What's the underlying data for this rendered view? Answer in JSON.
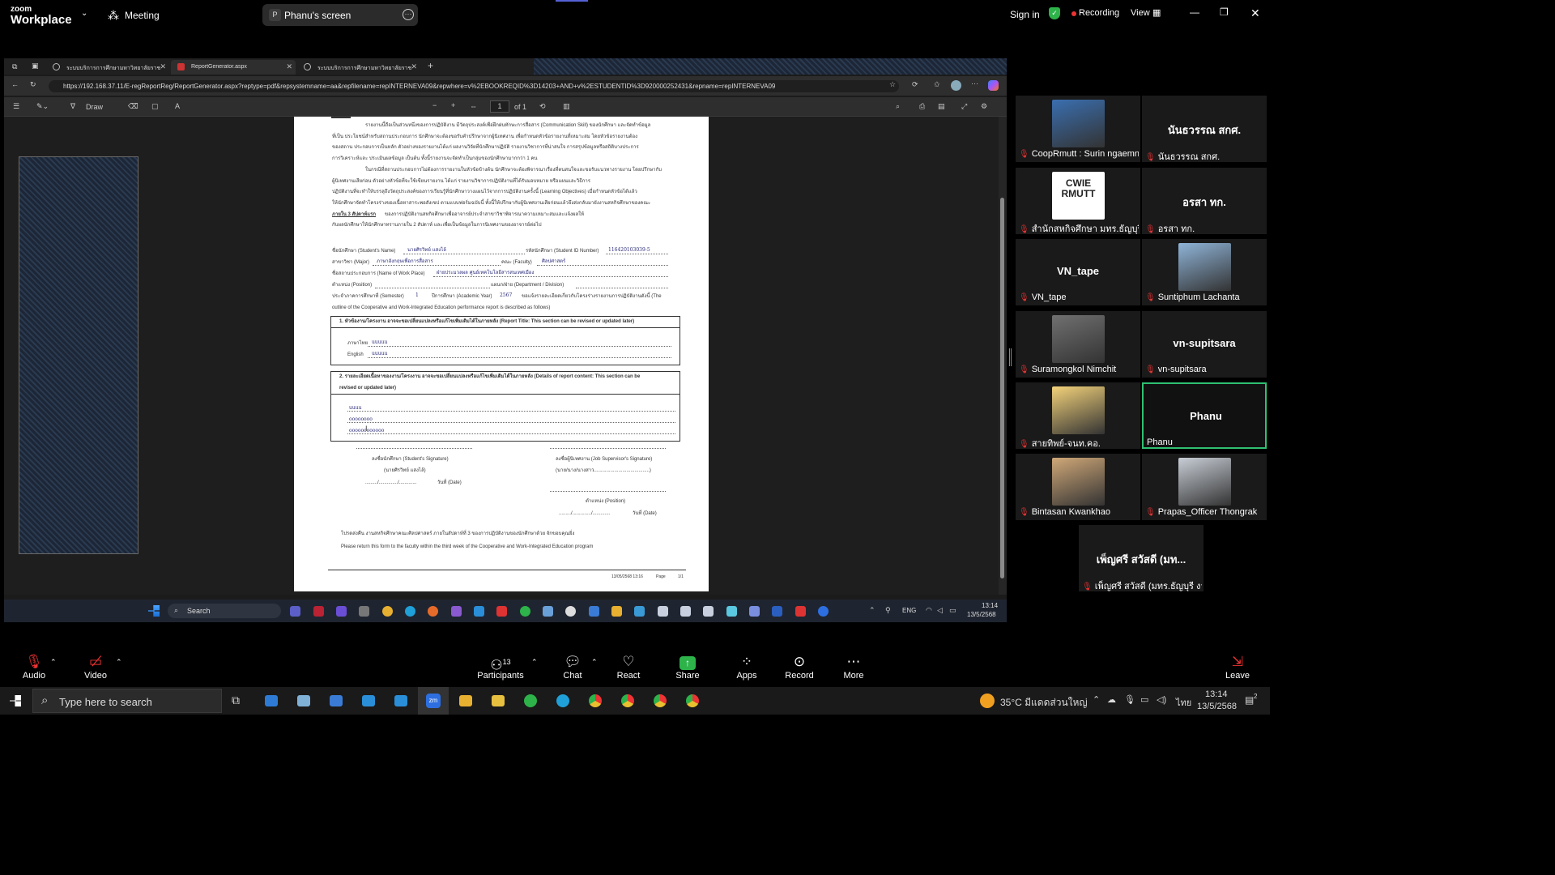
{
  "zoom_top": {
    "logo_small": "zoom",
    "logo_big": "Workplace",
    "meeting_label": "Meeting",
    "share_chip": "P",
    "share_label": "Phanu's screen",
    "sign_in": "Sign in",
    "recording": "Recording",
    "view": "View"
  },
  "browser": {
    "tabs": [
      {
        "label": "ระบบบริการการศึกษามหาวิทยาลัยราช"
      },
      {
        "label": "ReportGenerator.aspx"
      },
      {
        "label": "ระบบบริการการศึกษามหาวิทยาลัยราช"
      }
    ],
    "url": "https://192.168.37.11/E-regReportReg/ReportGenerator.aspx?reptype=pdf&repsystemname=aa&repfilename=repINTERNEVA09&repwhere=v%2EBOOKREQID%3D14203+AND+v%2ESTUDENTID%3D920000252431&repname=repINTERNEVA09",
    "pdf_draw": "Draw",
    "page_num": "1",
    "page_of": "of 1"
  },
  "document": {
    "intro1": "รายงานนี้ถือเป็นส่วนหนึ่งของการปฏิบัติงาน มีวัตถุประสงค์เพื่อฝึกฝนทักษะการสื่อสาร (Communication Skill) ของนักศึกษา และจัดทำข้อมูล",
    "intro2": "ที่เป็น ประโยชน์สำหรับสถานประกอบการ นักศึกษาจะต้องขอรับคำปรึกษาจากผู้นิเทศงาน เพื่อกำหนดหัวข้อรายงานที่เหมาะสม โดยหัวข้อรายงานต้อง",
    "intro3": "ของสถาน ประกอบการเป็นหลัก ตัวอย่างของรายงานได้แก่ ผลงานวิจัยที่นักศึกษาปฏิบัติ รายงานวิชาการที่น่าสนใจ การสรุปข้อมูลหรือสถิติบางประการ",
    "intro4": "การวิเคราะห์และ ประเมินผลข้อมูล เป็นต้น ทั้งนี้รายงานจะจัดทำเป็นกลุ่มของนักศึกษามากกว่า 1 คน",
    "intro5": "ในกรณีที่สถานประกอบการไม่ต้องการรายงานในหัวข้อข้างต้น นักศึกษาจะต้องพิจารณาเรื่องที่ตนสนใจและขอรับแนวทางรายงาน โดยปรึกษากับ",
    "intro6": "ผู้นิเทศงานเสียก่อน ตัวอย่างหัวข้อที่จะใช้เขียนรายงาน ได้แก่ รายงานวิชาการปฏิบัติงานที่ได้รับมอบหมาย หรือแผนและวิธีการ",
    "intro7": "ปฏิบัติงานที่จะทำให้บรรลุถึงวัตถุประสงค์ของการเรียนรู้ที่นักศึกษาวางแผนไว้จากการปฏิบัติงานครั้งนี้ (Learning Objectives) เมื่อกำหนดหัวข้อได้แล้ว",
    "intro8": "ให้นักศึกษาจัดทำโครงร่างของเนื้อหาสาระพอสังเขป ตามแบบฟอร์มฉบับนี้ ทั้งนี้ให้ปรึกษากับผู้นิเทศงานเสียก่อนแล้วจึงส่งกลับมายังงานสหกิจศึกษาของคณะ",
    "intro9_bold": "ภายใน 3 สัปดาห์แรก",
    "intro9": "ของการปฏิบัติงานสหกิจศึกษาเพื่ออาจารย์ประจำสาขาวิชาพิจารณาความเหมาะสมและแจ้งผลให้",
    "intro10": "กับผลนักศึกษาให้นักศึกษาทราบภายใน 2 สัปดาห์ และเพื่อเป็นข้อมูลในการนิเทศงานของอาจารย์ต่อไป",
    "student_name_label": "ชื่อนักศึกษา (Student's Name)",
    "student_name": "นายศิรวิทย์ แสงไล้",
    "student_id_label": "รหัสนักศึกษา (Student ID Number)",
    "student_id": "116420103039-5",
    "major_label": "สาขาวิชา (Major)",
    "major": "ภาษาอังกฤษเพื่อการสื่อสาร",
    "faculty_label": "คณะ (Faculty)",
    "faculty": "ศิลปศาสตร์",
    "workplace_label": "ชื่อสถานประกอบการ (Name of Work Place)",
    "workplace": "ฝ่ายประมวลผล ศูนย์เทคโนโลยีสารสนเทศเมือง",
    "position_label": "ตำแหน่ง (Position)",
    "dept_label": "แผนก/ฝ่าย (Department / Division)",
    "semester_label": "ประจำภาคการศึกษาที่ (Semester)",
    "semester": "1",
    "year_label": "ปีการศึกษา (Academic Year)",
    "year": "2567",
    "semester_tail": "ขอแจ้งรายละเอียดเกี่ยวกับโครงร่างรายงานการปฏิบัติงานดังนี้ (The",
    "outline_line": "outline of the Cooperative and Work-Integrated Education performance report is described as follows)",
    "box1_title": "1. หัวข้องาน/โครงงาน อาจจะขอเปลี่ยนแปลงหรือแก้ไขเพิ่มเติมได้ในภายหลัง (Report Title: This section can be revised or updated later)",
    "thai_label": "ภาษาไทย",
    "thai_val": "uuuuu",
    "english_label": "English",
    "english_val": "uuuuu",
    "box2_title1": "2. รายละเอียดเนื้อหาของงาน/โครงงาน อาจจะขอเปลี่ยนแปลงหรือแก้ไขเพิ่มเติมได้ในภายหลัง (Details of report content: This section can be",
    "box2_title2": "revised or updated later)",
    "detail1": "uuuu",
    "detail2": "oooooooo",
    "detail3": "oooooooooooo",
    "sig_student": "ลงชื่อนักศึกษา (Student's Signature)",
    "sig_student_name": "(นายศิรวิทย์ แสงไล้)",
    "sig_date": "วันที่ (Date)",
    "sig_supervisor": "ลงชื่อผู้นิเทศงาน (Job Supervisor's Signature)",
    "sig_supervisor_name": "(นาย/นาง/นางสาว.........................................)",
    "sig_position": "ตำแหน่ง (Position)",
    "sig_date2": "วันที่ (Date)",
    "return_th": "โปรดส่งคืน งานสหกิจศึกษาคณะศิลปศาสตร์ ภายในสัปดาห์ที่ 3 ของการปฏิบัติงานของนักศึกษาด้วย จักขอบคุณยิ่ง",
    "return_en": "Please return this form to the faculty within the third week of the Cooperative and Work-Integrated Education program",
    "footer_date": "13/05/2568 13:16",
    "footer_page_label": "Page",
    "footer_page": "1/1"
  },
  "win_inner": {
    "search": "Search",
    "lang": "ENG",
    "time": "13:14",
    "date": "13/5/2568"
  },
  "participants": [
    {
      "name": "CoopRmutt : Surin ngaemn...",
      "kind": "photo",
      "color": "#3a6fb0"
    },
    {
      "name": "นันธวรรณ สกศ.",
      "kind": "text",
      "display": "นันธวรรณ สกศ."
    },
    {
      "name": "สำนักสหกิจศึกษา มทร.ธัญบุรี",
      "kind": "logo",
      "logo1": "CWIE",
      "logo2": "RMUTT"
    },
    {
      "name": "อรสา ทก.",
      "kind": "text",
      "display": "อรสา ทก."
    },
    {
      "name": "VN_tape",
      "kind": "text",
      "display": "VN_tape"
    },
    {
      "name": "Suntiphum Lachanta",
      "kind": "photo",
      "color": "#8fb4d8"
    },
    {
      "name": "Suramongkol Nimchit",
      "kind": "photo",
      "color": "#707070"
    },
    {
      "name": "vn-supitsara",
      "kind": "text",
      "display": "vn-supitsara"
    },
    {
      "name": "สายทิพย์-จนท.คอ.",
      "kind": "photo",
      "color": "#f3d27a"
    },
    {
      "name": "Phanu",
      "kind": "active",
      "display": "Phanu"
    },
    {
      "name": "Bintasan Kwankhao",
      "kind": "photo",
      "color": "#d0a878"
    },
    {
      "name": "Prapas_Officer Thongrak",
      "kind": "photo",
      "color": "#c8ced6"
    },
    {
      "name": "เพ็ญศรี สวัสดี (มทร.ธัญบุรี งาน...",
      "kind": "text",
      "display": "เพ็ญศรี สวัสดี (มท..."
    }
  ],
  "zoom_bottom": {
    "audio": "Audio",
    "video": "Video",
    "participants": "Participants",
    "participants_count": "13",
    "chat": "Chat",
    "react": "React",
    "share": "Share",
    "apps": "Apps",
    "record": "Record",
    "more": "More",
    "leave": "Leave"
  },
  "win_taskbar": {
    "search_placeholder": "Type here to search",
    "weather": "35°C มีแดดส่วนใหญ่",
    "lang": "ไทย",
    "time": "13:14",
    "date": "13/5/2568",
    "notif": "2"
  }
}
